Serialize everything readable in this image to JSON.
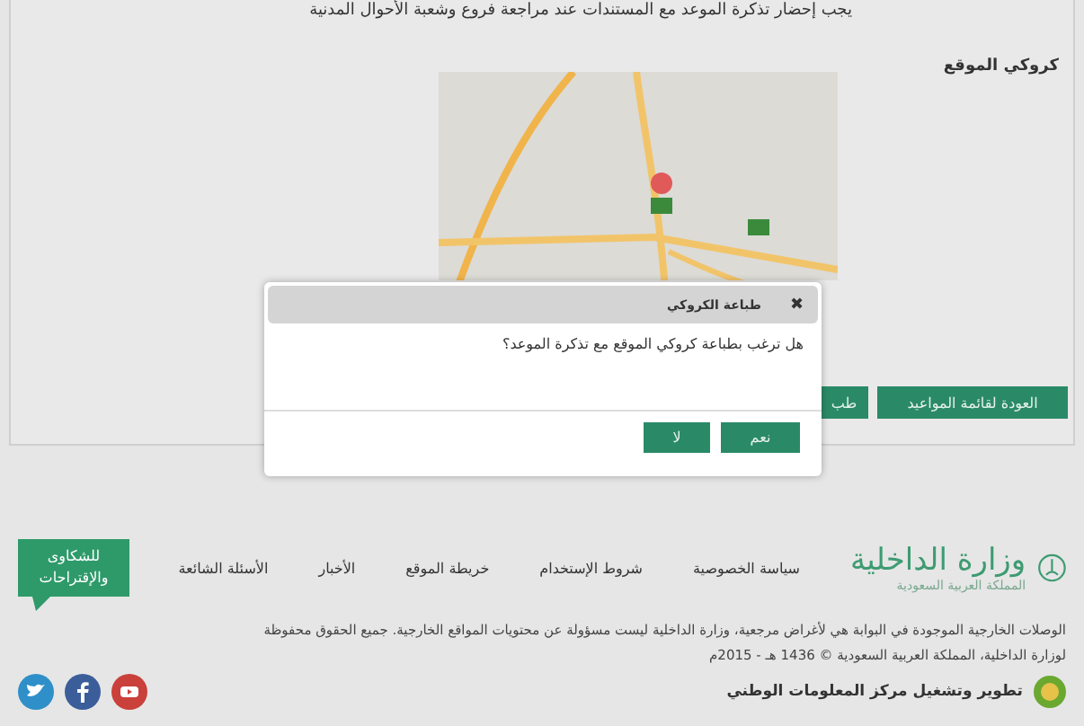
{
  "notice": "يجب إحضار تذكرة الموعد مع المستندات عند مراجعة فروع وشعبة الأحوال المدنية",
  "map_section": {
    "label": "كروكي الموقع"
  },
  "actions": [
    {
      "label": "العودة لقائمة المواعيد"
    },
    {
      "label": "طب"
    }
  ],
  "dialog": {
    "title": "طباعة الكروكي",
    "close": "✖",
    "message": "هل ترغب بطباعة كروكي الموقع مع تذكرة الموعد؟",
    "buttons": [
      {
        "label": "نعم"
      },
      {
        "label": "لا"
      }
    ]
  },
  "footer": {
    "brand": {
      "name": "وزارة الداخلية",
      "subtitle": "المملكة العربية السعودية"
    },
    "links": [
      "سياسة الخصوصية",
      "شروط الإستخدام",
      "خريطة الموقع",
      "الأخبار",
      "الأسئلة الشائعة"
    ],
    "feedback": "للشكاوى والإقتراحات",
    "disclaimer": "الوصلات الخارجية الموجودة في البوابة هي لأغراض مرجعية، وزارة الداخلية ليست مسؤولة عن محتويات المواقع الخارجية. جميع الحقوق محفوظة لوزارة الداخلية، المملكة العربية السعودية © 1436 هـ - 2015م",
    "credit": "تطوير وتشغيل مركز المعلومات الوطني"
  }
}
